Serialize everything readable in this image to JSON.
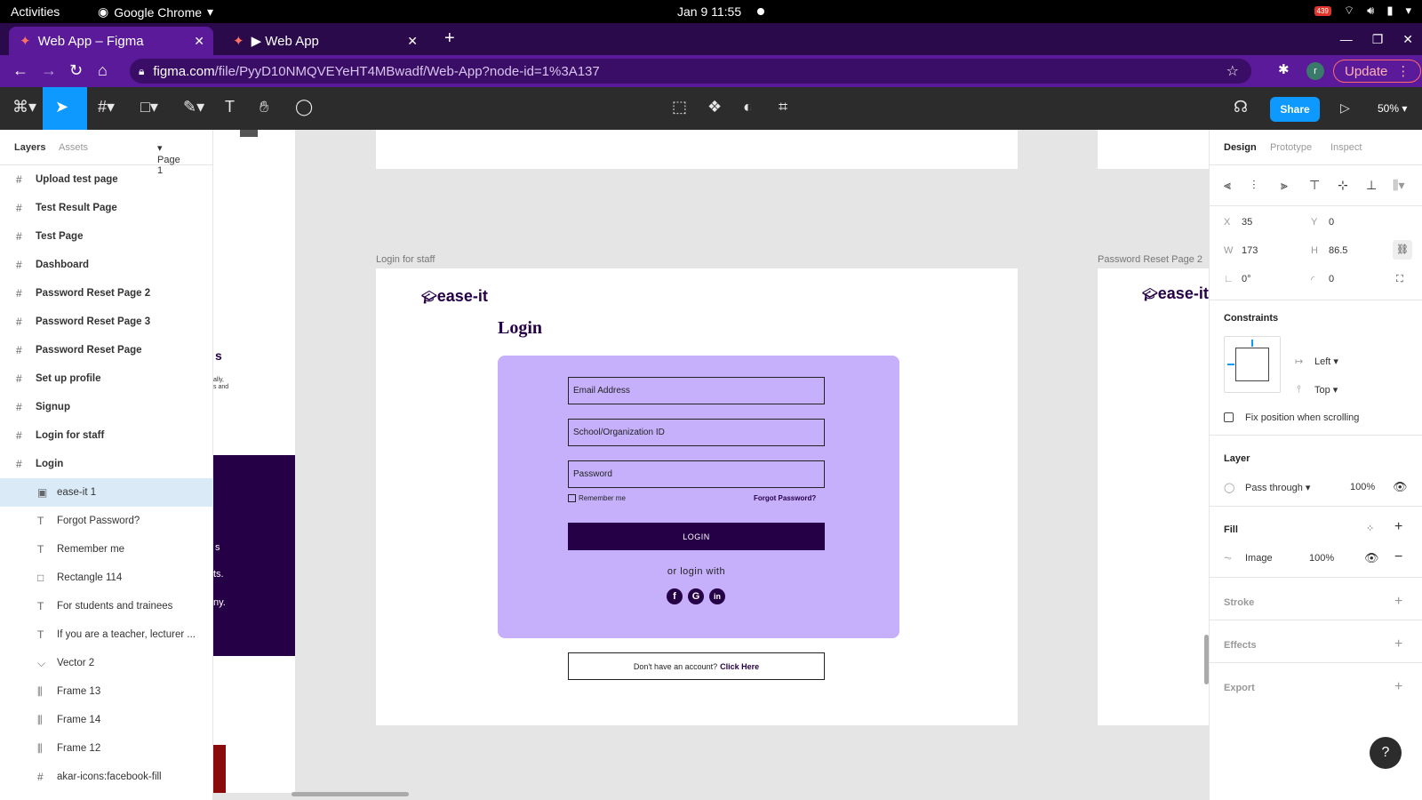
{
  "system": {
    "activities": "Activities",
    "app_name": "Google Chrome",
    "clock": "Jan 9  11:55",
    "notif_badge": "439"
  },
  "browser": {
    "tabs": [
      {
        "title": "Web App – Figma"
      },
      {
        "title": "▶ Web App"
      }
    ],
    "url_host": "figma.com",
    "url_path": "/file/PyyD10NMQVEYeHT4MBwadf/Web-App?node-id=1%3A137",
    "update_label": "Update",
    "avatar_letter": "r"
  },
  "toolbar": {
    "share_label": "Share",
    "zoom": "50%"
  },
  "left_panel": {
    "tabs": [
      "Layers",
      "Assets"
    ],
    "page_selector": "Page 1",
    "layers": [
      {
        "label": "Upload test page",
        "kind": "frame"
      },
      {
        "label": "Test Result Page",
        "kind": "frame"
      },
      {
        "label": "Test Page",
        "kind": "frame"
      },
      {
        "label": "Dashboard",
        "kind": "frame"
      },
      {
        "label": "Password Reset Page 2",
        "kind": "frame"
      },
      {
        "label": "Password Reset Page 3",
        "kind": "frame"
      },
      {
        "label": "Password Reset Page",
        "kind": "frame"
      },
      {
        "label": "Set up profile",
        "kind": "frame"
      },
      {
        "label": "Signup",
        "kind": "frame"
      },
      {
        "label": "Login for staff",
        "kind": "frame"
      },
      {
        "label": "Login",
        "kind": "frame"
      },
      {
        "label": "ease-it 1",
        "kind": "image"
      },
      {
        "label": "Forgot Password?",
        "kind": "text"
      },
      {
        "label": "Remember me",
        "kind": "text"
      },
      {
        "label": "Rectangle 114",
        "kind": "rect"
      },
      {
        "label": "For students and trainees",
        "kind": "text"
      },
      {
        "label": "If you are a teacher, lecturer ...",
        "kind": "text"
      },
      {
        "label": "Vector 2",
        "kind": "vector"
      },
      {
        "label": "Frame 13",
        "kind": "autolayout"
      },
      {
        "label": "Frame 14",
        "kind": "autolayout"
      },
      {
        "label": "Frame 12",
        "kind": "autolayout"
      },
      {
        "label": "akar-icons:facebook-fill",
        "kind": "frame"
      }
    ]
  },
  "canvas": {
    "frame_labels": {
      "login_staff": "Login for staff",
      "password_reset_2": "Password Reset Page 2"
    },
    "partial_text": {
      "t1": "s",
      "t2": "ally,",
      "t3": "s and",
      "t4": "s",
      "t5": "ts.",
      "t6": "ny."
    },
    "login_page": {
      "logo": "ease-it",
      "heading": "Login",
      "email_placeholder": "Email Address",
      "org_placeholder": "School/Organization ID",
      "password_placeholder": "Password",
      "remember_me": "Remember me",
      "forgot_password": "Forgot Password?",
      "login_button": "LOGIN",
      "or_login_with": "or login with",
      "social": [
        "f",
        "G",
        "in"
      ],
      "signup_prompt": "Don't have an account?",
      "signup_link": "Click Here"
    }
  },
  "right_panel": {
    "tabs": [
      "Design",
      "Prototype",
      "Inspect"
    ],
    "x_label": "X",
    "x": "35",
    "y_label": "Y",
    "y": "0",
    "w_label": "W",
    "w": "173",
    "h_label": "H",
    "h": "86.5",
    "rotation": "0°",
    "radius": "0",
    "constraints_title": "Constraints",
    "constraint_h": "Left",
    "constraint_v": "Top",
    "fix_position": "Fix position when scrolling",
    "layer_title": "Layer",
    "blend": "Pass through",
    "opacity": "100%",
    "fill_title": "Fill",
    "fill_type": "Image",
    "fill_opacity": "100%",
    "stroke_title": "Stroke",
    "effects_title": "Effects",
    "export_title": "Export",
    "help": "?"
  },
  "colors": {
    "accent": "#0d99ff",
    "browser_purple": "#5a1a9a",
    "card_lavender": "#c6b0fb",
    "brand_dark": "#260046",
    "logo_gold": "#e8b400"
  }
}
